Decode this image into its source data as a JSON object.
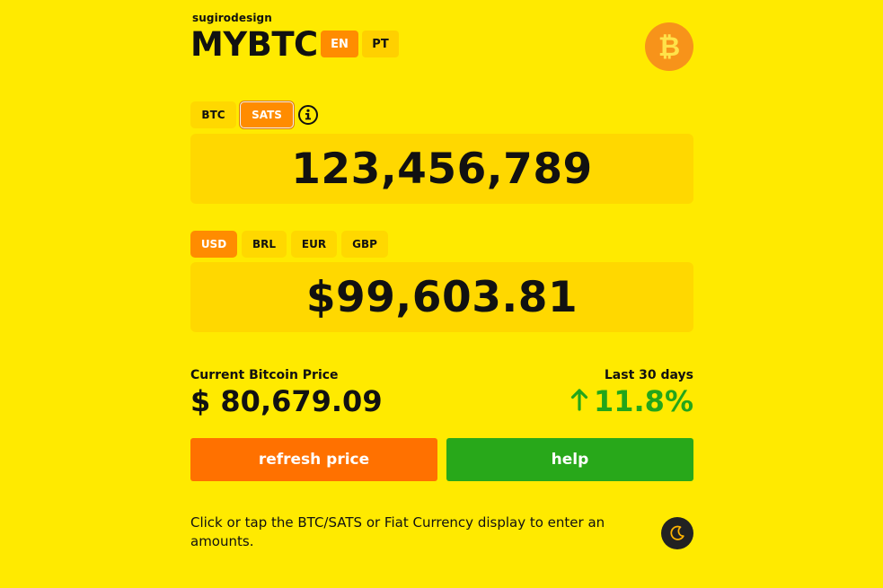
{
  "header": {
    "brand_small": "sugirodesign",
    "title": "MYBTC",
    "languages": [
      {
        "label": "EN",
        "active": true
      },
      {
        "label": "PT",
        "active": false
      }
    ],
    "logo_icon": "bitcoin-logo-icon"
  },
  "crypto": {
    "units": [
      {
        "label": "BTC",
        "active": false
      },
      {
        "label": "SATS",
        "active": true
      }
    ],
    "info_icon": "info-icon",
    "display_value": "123,456,789"
  },
  "fiat": {
    "currencies": [
      {
        "label": "USD",
        "active": true
      },
      {
        "label": "BRL",
        "active": false
      },
      {
        "label": "EUR",
        "active": false
      },
      {
        "label": "GBP",
        "active": false
      }
    ],
    "display_value": "$99,603.81"
  },
  "price": {
    "label": "Current Bitcoin Price",
    "value": "$ 80,679.09"
  },
  "change": {
    "label": "Last 30 days",
    "value": "11.8%",
    "direction_icon": "arrow-up-icon"
  },
  "actions": {
    "refresh_label": "refresh price",
    "help_label": "help"
  },
  "footer": {
    "hint": "Click or tap the BTC/SATS or Fiat Currency display to enter an amounts.",
    "theme_icon": "moon-icon"
  },
  "colors": {
    "background": "#ffea00",
    "accent_orange": "#ff8c00",
    "refresh_orange": "#ff7100",
    "success_green": "#28a81a",
    "bitcoin_orange": "#f7931a"
  }
}
